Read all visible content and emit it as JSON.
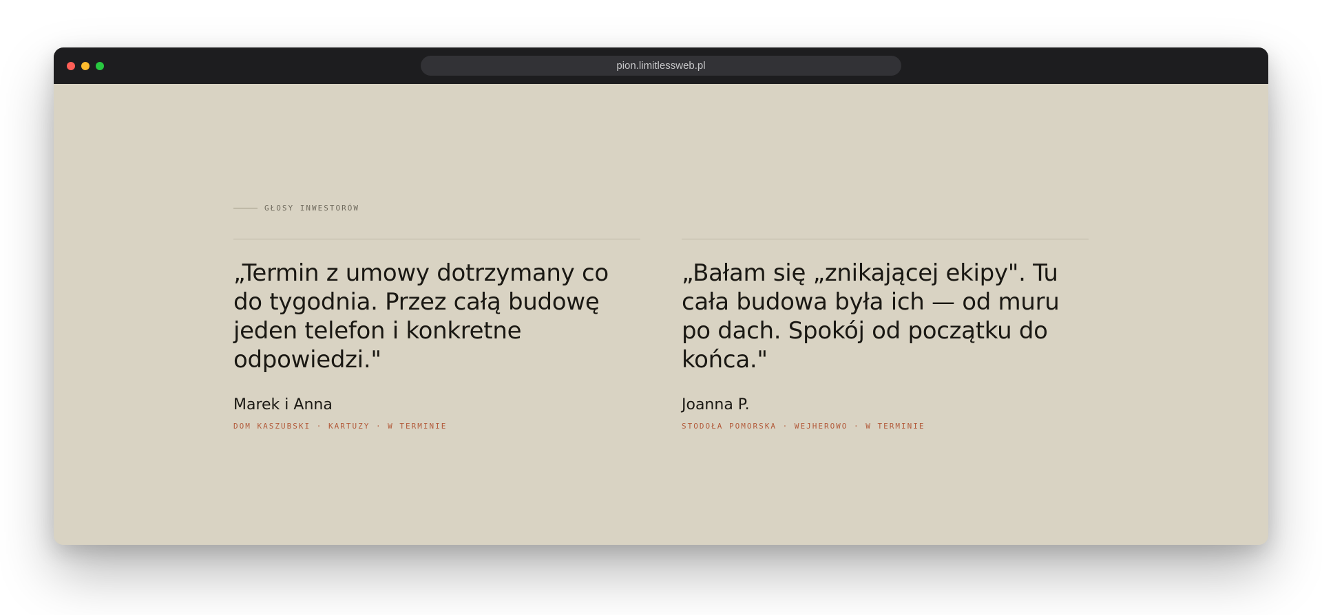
{
  "browser": {
    "url": "pion.limitlessweb.pl"
  },
  "section": {
    "eyebrow": "GŁOSY INWESTORÓW"
  },
  "testimonials": [
    {
      "quote": "„Termin z umowy dotrzymany co do tygodnia. Przez całą budowę jeden telefon i konkretne odpowiedzi.\"",
      "author": "Marek i Anna",
      "meta": "DOM KASZUBSKI · KARTUZY · W TERMINIE"
    },
    {
      "quote": "„Bałam się „znikającej ekipy\". Tu cała budowa była ich — od muru po dach. Spokój od początku do końca.\"",
      "author": "Joanna P.",
      "meta": "STODOŁA POMORSKA · WEJHEROWO · W TERMINIE"
    }
  ],
  "colors": {
    "background": "#d9d3c3",
    "titlebar": "#1d1d1f",
    "text": "#1a1813",
    "accent": "#b25a3a"
  }
}
